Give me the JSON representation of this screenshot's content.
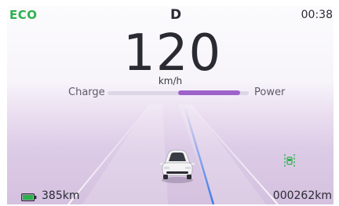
{
  "status_bar": {
    "drive_mode": "ECO",
    "gear": "D",
    "time": "00:38"
  },
  "speedometer": {
    "speed": "120",
    "unit": "km/h"
  },
  "power_meter": {
    "left_label": "Charge",
    "right_label": "Power",
    "power_level_percent": 44
  },
  "bottom_bar": {
    "range": "385km",
    "odometer": "000262km"
  },
  "icons": [
    "battery-icon",
    "car-icon",
    "lane-assist-icon"
  ],
  "colors": {
    "eco_green": "#2bb24c",
    "power_purple": "#9d62c9",
    "lane_blue": "#3d7be8",
    "text_dark": "#2a2a33"
  }
}
